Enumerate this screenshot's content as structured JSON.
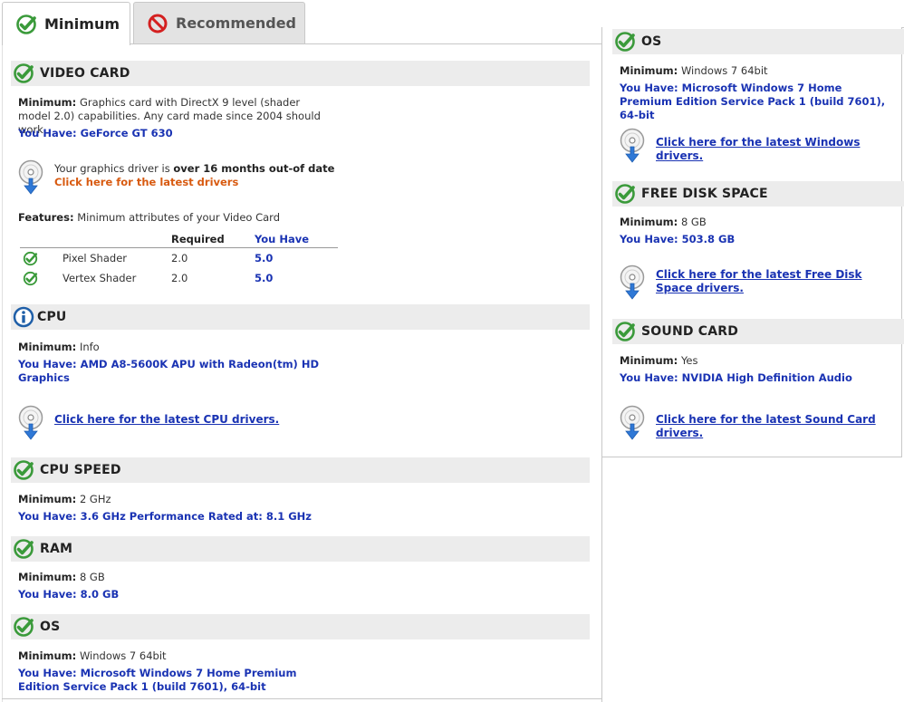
{
  "tabs": [
    {
      "label": "Minimum",
      "icon": "check-icon"
    },
    {
      "label": "Recommended",
      "icon": "no-icon"
    }
  ],
  "labels": {
    "minimum": "Minimum:",
    "you_have": "You Have:",
    "features": "Features:"
  },
  "left": {
    "video_card": {
      "title": "VIDEO CARD",
      "minimum": "Graphics card with DirectX 9 level (shader model 2.0) capabilities. Any card made since 2004 should work",
      "you_have": "GeForce GT 630",
      "driver_text": "Your graphics driver is ",
      "driver_bold": "over 16 months out-of date",
      "driver_link": "Click here for the latest drivers",
      "features_text": "Minimum attributes of your Video Card",
      "table": {
        "headers": [
          "",
          "",
          "Required",
          "You Have"
        ],
        "rows": [
          {
            "name": "Pixel Shader",
            "required": "2.0",
            "have": "5.0"
          },
          {
            "name": "Vertex Shader",
            "required": "2.0",
            "have": "5.0"
          }
        ]
      }
    },
    "cpu": {
      "title": "CPU",
      "minimum": "Info",
      "you_have": "AMD A8-5600K APU with Radeon(tm) HD Graphics",
      "link": "Click here for the latest CPU drivers."
    },
    "cpu_speed": {
      "title": "CPU SPEED",
      "minimum": "2 GHz",
      "you_have": "3.6 GHz Performance Rated at: 8.1 GHz"
    },
    "ram": {
      "title": "RAM",
      "minimum": "8 GB",
      "you_have": "8.0 GB"
    },
    "os": {
      "title": "OS",
      "minimum": "Windows 7 64bit",
      "you_have": "Microsoft Windows 7 Home Premium Edition Service Pack 1 (build 7601), 64-bit"
    }
  },
  "right": {
    "os": {
      "title": "OS",
      "minimum": "Windows 7 64bit",
      "you_have": "Microsoft Windows 7 Home Premium Edition Service Pack 1 (build 7601), 64-bit",
      "link": "Click here for the latest Windows drivers."
    },
    "disk": {
      "title": "FREE DISK SPACE",
      "minimum": "8 GB",
      "you_have": "503.8 GB",
      "link": "Click here for the latest Free Disk Space drivers."
    },
    "sound": {
      "title": "SOUND CARD",
      "minimum": "Yes",
      "you_have": "NVIDIA High Definition Audio",
      "link": "Click here for the latest Sound Card drivers."
    }
  },
  "colors": {
    "check_green": "#3a9a3a",
    "have_blue": "#1a33b3",
    "link_orange": "#d85a10",
    "header_gray": "#ececec",
    "no_red": "#d42020",
    "info_blue": "#1f5fa8"
  }
}
